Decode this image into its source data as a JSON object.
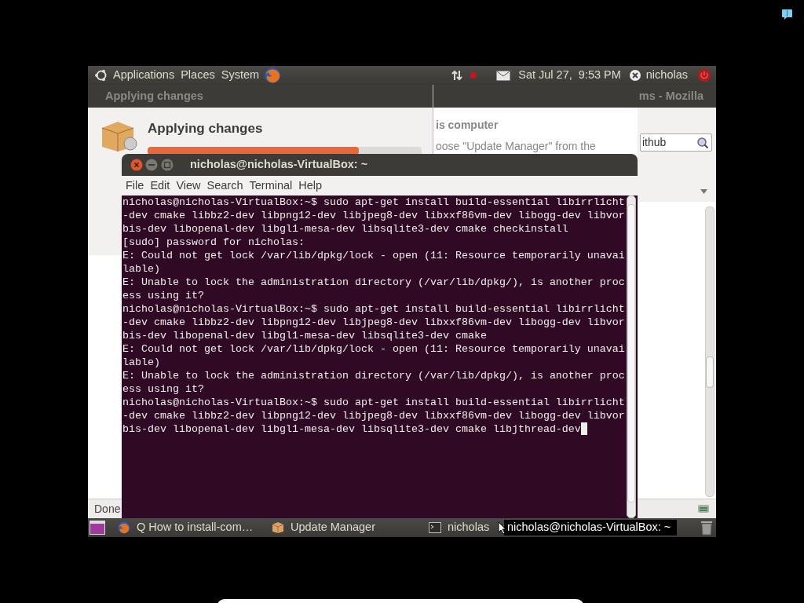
{
  "top_panel": {
    "menus": [
      "Applications",
      "Places",
      "System"
    ],
    "clock": "Sat Jul 27,  9:53 PM",
    "user": "nicholas"
  },
  "firefox": {
    "title": "ms - Mozilla",
    "heading": "is computer",
    "text": "oose \"Update Manager\" from the",
    "search": {
      "value": "ithub"
    },
    "status": "Done"
  },
  "update_manager": {
    "title": "Applying changes",
    "heading": "Applying changes",
    "progress": {
      "level": 0.77
    }
  },
  "terminal": {
    "title": "nicholas@nicholas-VirtualBox: ~",
    "menus": [
      "File",
      "Edit",
      "View",
      "Search",
      "Terminal",
      "Help"
    ],
    "lines": [
      "nicholas@nicholas-VirtualBox:~$ sudo apt-get install build-essential libirrlicht",
      "-dev cmake libbz2-dev libpng12-dev libjpeg8-dev libxxf86vm-dev libogg-dev libvor",
      "bis-dev libopenal-dev libgl1-mesa-dev libsqlite3-dev cmake checkinstall",
      "[sudo] password for nicholas:",
      "E: Could not get lock /var/lib/dpkg/lock - open (11: Resource temporarily unavai",
      "lable)",
      "E: Unable to lock the administration directory (/var/lib/dpkg/), is another proc",
      "ess using it?",
      "nicholas@nicholas-VirtualBox:~$ sudo apt-get install build-essential libirrlicht",
      "-dev cmake libbz2-dev libpng12-dev libjpeg8-dev libxxf86vm-dev libogg-dev libvor",
      "bis-dev libopenal-dev libgl1-mesa-dev libsqlite3-dev cmake",
      "E: Could not get lock /var/lib/dpkg/lock - open (11: Resource temporarily unavai",
      "lable)",
      "E: Unable to lock the administration directory (/var/lib/dpkg/), is another proc",
      "ess using it?",
      "nicholas@nicholas-VirtualBox:~$ sudo apt-get install build-essential libirrlicht",
      "-dev cmake libbz2-dev libpng12-dev libjpeg8-dev libxxf86vm-dev libogg-dev libvor",
      "bis-dev libopenal-dev libgl1-mesa-dev libsqlite3-dev cmake libjthread-dev"
    ]
  },
  "taskbar": {
    "items": [
      {
        "kind": "browser",
        "label": "Q How to install-com…"
      },
      {
        "kind": "package",
        "label": "Update Manager"
      },
      {
        "kind": "terminal",
        "label": "nicholas"
      }
    ]
  },
  "tooltip": "nicholas@nicholas-VirtualBox: ~"
}
